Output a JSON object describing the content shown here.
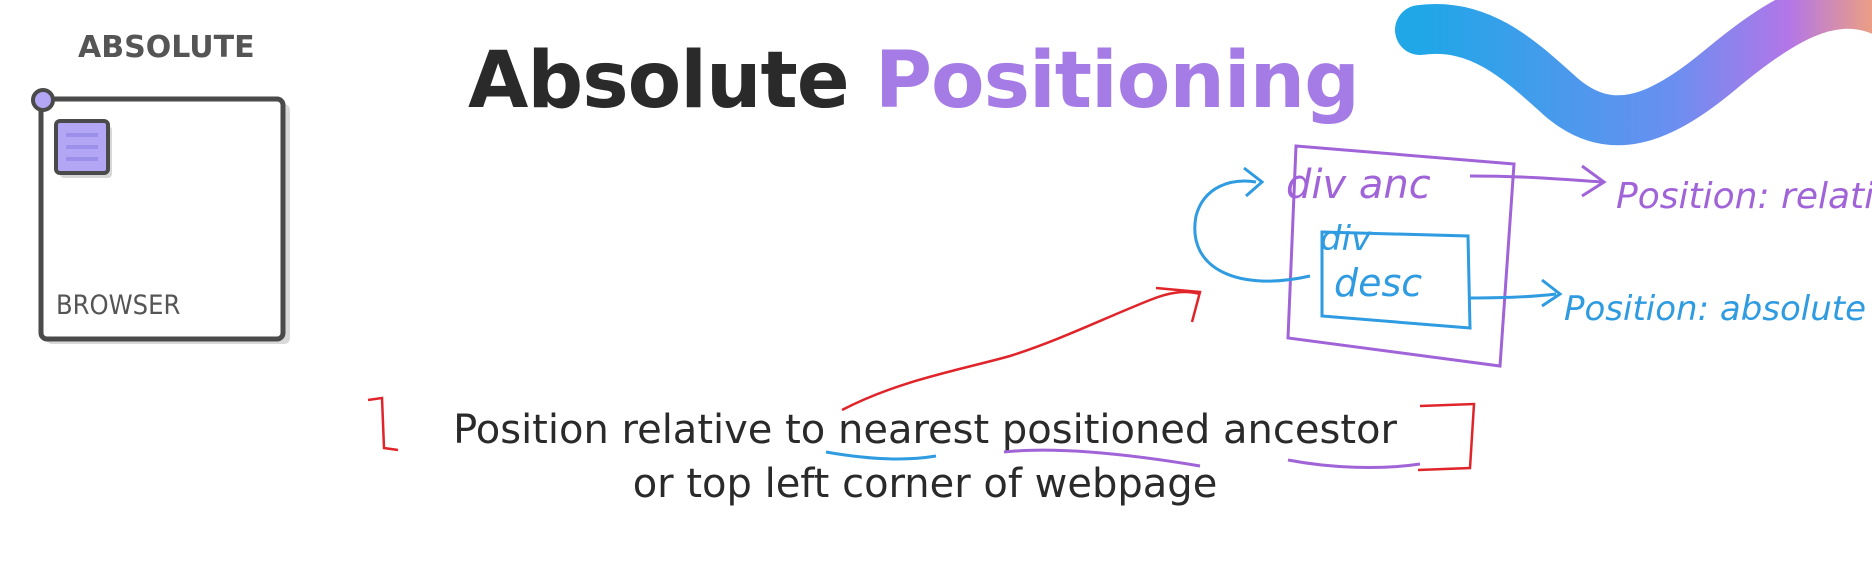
{
  "slide": {
    "side_label": "ABSOLUTE",
    "browser_label": "BROWSER",
    "title_part1": "Absolute",
    "title_part2": "Positioning",
    "caption_line1": "Position relative to nearest positioned ancestor",
    "caption_line2": "or top left corner of webpage"
  },
  "annotations": {
    "parent_label": "div anc",
    "child_label_1": "div",
    "child_label_2": "desc",
    "parent_position": "Position: relative",
    "child_position": "Position: absolute"
  },
  "colors": {
    "title_dark": "#2a2a2a",
    "accent_purple": "#a57be6",
    "ink_blue": "#2f9be0",
    "ink_purple": "#a064d8",
    "ink_red": "#e0252a",
    "frame_gray": "#4a4a4a",
    "doc_icon": "#b3a6f5"
  }
}
